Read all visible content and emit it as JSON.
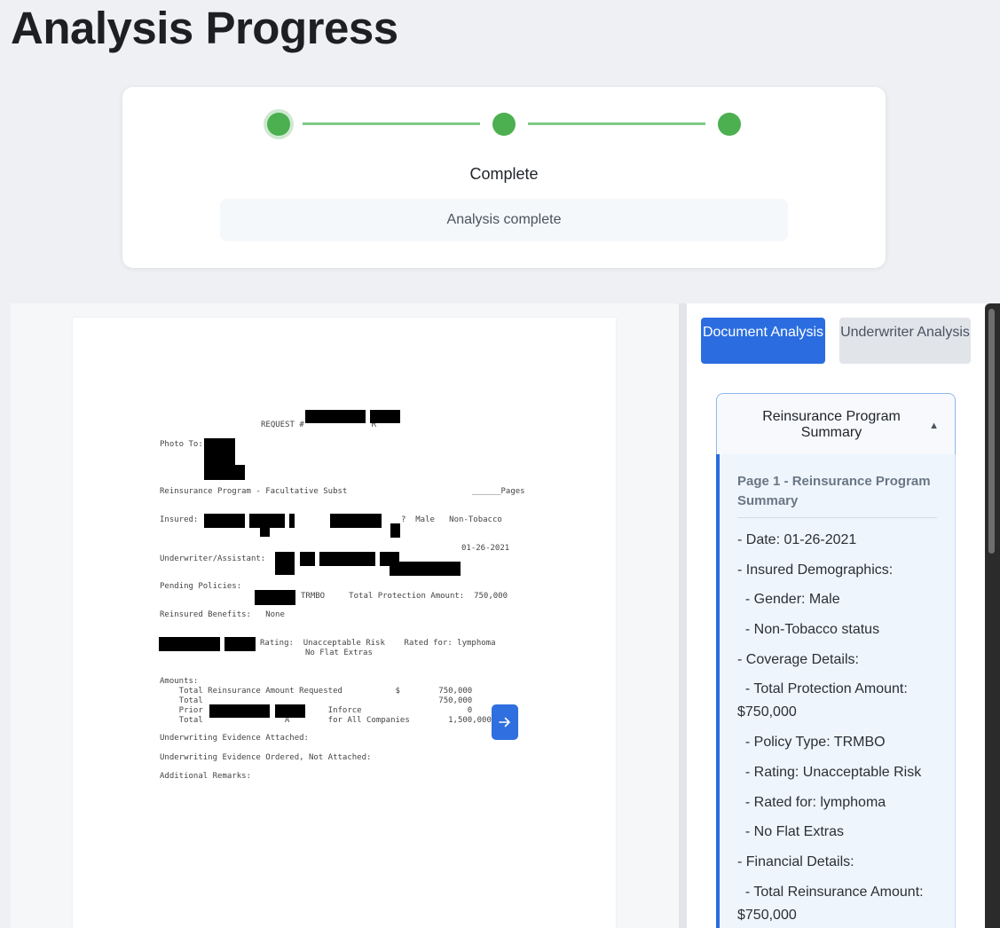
{
  "page": {
    "title": "Analysis Progress"
  },
  "progress": {
    "steps": [
      "",
      "",
      ""
    ],
    "status_label": "Complete",
    "status_message": "Analysis complete"
  },
  "document": {
    "nav_arrow_icon": "arrow-right-icon",
    "lines": {
      "request": "REQUEST #              R",
      "photo_to": "Photo To:",
      "program": "Reinsurance Program - Facultative Subst",
      "pages": "______Pages",
      "insured": "Insured:",
      "insured_tail": "?  Male   Non-Tobacco",
      "date": "01-26-2021",
      "uw": "Underwriter/Assistant:",
      "pending": "Pending Policies:",
      "pending_tail": "TRMBO     Total Protection Amount:  750,000",
      "benefits": "Reinsured Benefits:   None",
      "rating": "Rating:  Unacceptable Risk    Rated for: lymphoma",
      "flat": "No Flat Extras",
      "amounts": "Amounts:\n    Total Reinsurance Amount Requested           $        750,000\n    Total                                                 750,000\n    Prior                          Inforce                      0\n    Total                 A        for All Companies        1,500,000",
      "evidence_attached": "Underwriting Evidence Attached:",
      "evidence_ordered": "Underwriting Evidence Ordered, Not Attached:",
      "remarks": "Additional Remarks:"
    }
  },
  "tabs": {
    "document_analysis": "Document Analysis",
    "underwriter_analysis": "Underwriter Analysis"
  },
  "summary": {
    "accordion_title": "Reinsurance Program Summary",
    "caret": "▲",
    "section_heading": "Page 1 - Reinsurance Program Summary",
    "lines": [
      "- Date: 01-26-2021",
      "- Insured Demographics:",
      "  - Gender: Male",
      "  - Non-Tobacco status",
      "- Coverage Details:",
      "  - Total Protection Amount: $750,000",
      "  - Policy Type: TRMBO",
      "  - Rating: Unacceptable Risk",
      "  - Rated for: lymphoma",
      "  - No Flat Extras",
      "- Financial Details:",
      "  - Total Reinsurance Amount: $750,000"
    ]
  },
  "colors": {
    "primary": "#2b6de0",
    "step_complete": "#4caf50"
  }
}
